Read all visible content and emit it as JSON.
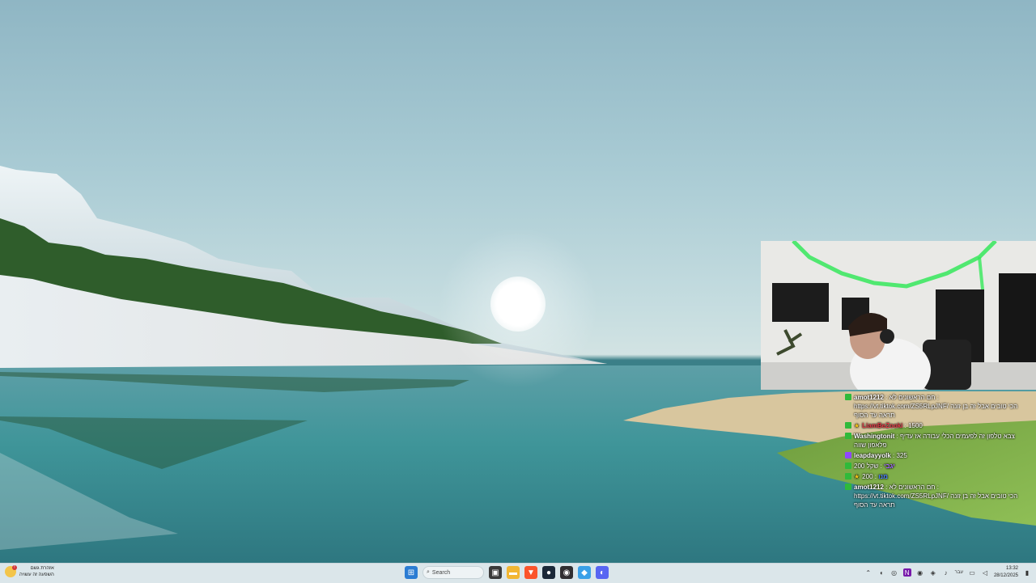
{
  "chat": {
    "messages": [
      {
        "badge": "kick",
        "user": "amot1212",
        "user_color": "#ffffff",
        "text": "חם הראשונים לא : https://vt.tiktok.com/ZS5RLpJNF/ הכי טובים אבל זה בן זונה תראה עד הסוף"
      },
      {
        "badge": "kick",
        "user": "LiamBeZooki",
        "user_color": "#e63946",
        "text": "1500",
        "star": true
      },
      {
        "badge": "kick",
        "user": "Washingtonit",
        "user_color": "#ffffff",
        "text": "צבא טלפון זה לפעמים הכלי עבודה אז עדיף פלאפון שווה"
      },
      {
        "badge": "twitch",
        "user": "leapdayyolk",
        "user_color": "#ffffff",
        "text": "325"
      },
      {
        "badge": "kick",
        "user": "‏יגבי",
        "user_color": "#a46bff",
        "text": "שקל 200"
      },
      {
        "badge": "kick",
        "user": "‏מנו",
        "user_color": "#4a7cff",
        "text": "200",
        "star": true
      },
      {
        "badge": "kick",
        "user": "amot1212",
        "user_color": "#ffffff",
        "text": "חם הראשונים לא : https://vt.tiktok.com/ZS5RLpJNF/ הכי טובים אבל זה בן זונה תראה עד הסוף"
      }
    ]
  },
  "taskbar": {
    "weather_line1": "אזהרת גשם",
    "weather_line2": "השפעה זה עשויה",
    "weather_alert": "!",
    "search_placeholder": "Search",
    "pinned": [
      {
        "icon": "windows-start-icon",
        "color": "#2b7cd3",
        "glyph": "⊞"
      },
      {
        "icon": "task-view-icon",
        "color": "#3a3a3a",
        "glyph": "▣"
      },
      {
        "icon": "file-explorer-icon",
        "color": "#f2b632",
        "glyph": "▬"
      },
      {
        "icon": "brave-browser-icon",
        "color": "#fb542b",
        "glyph": "▼"
      },
      {
        "icon": "steam-icon",
        "color": "#1b2838",
        "glyph": "●"
      },
      {
        "icon": "obs-icon",
        "color": "#302e31",
        "glyph": "◉"
      },
      {
        "icon": "copilot-icon",
        "color": "#3aa0e8",
        "glyph": "◆"
      },
      {
        "icon": "discord-icon",
        "color": "#5865f2",
        "glyph": "◐"
      }
    ],
    "lang": "עבר",
    "time": "13:32",
    "date": "28/12/2025"
  }
}
